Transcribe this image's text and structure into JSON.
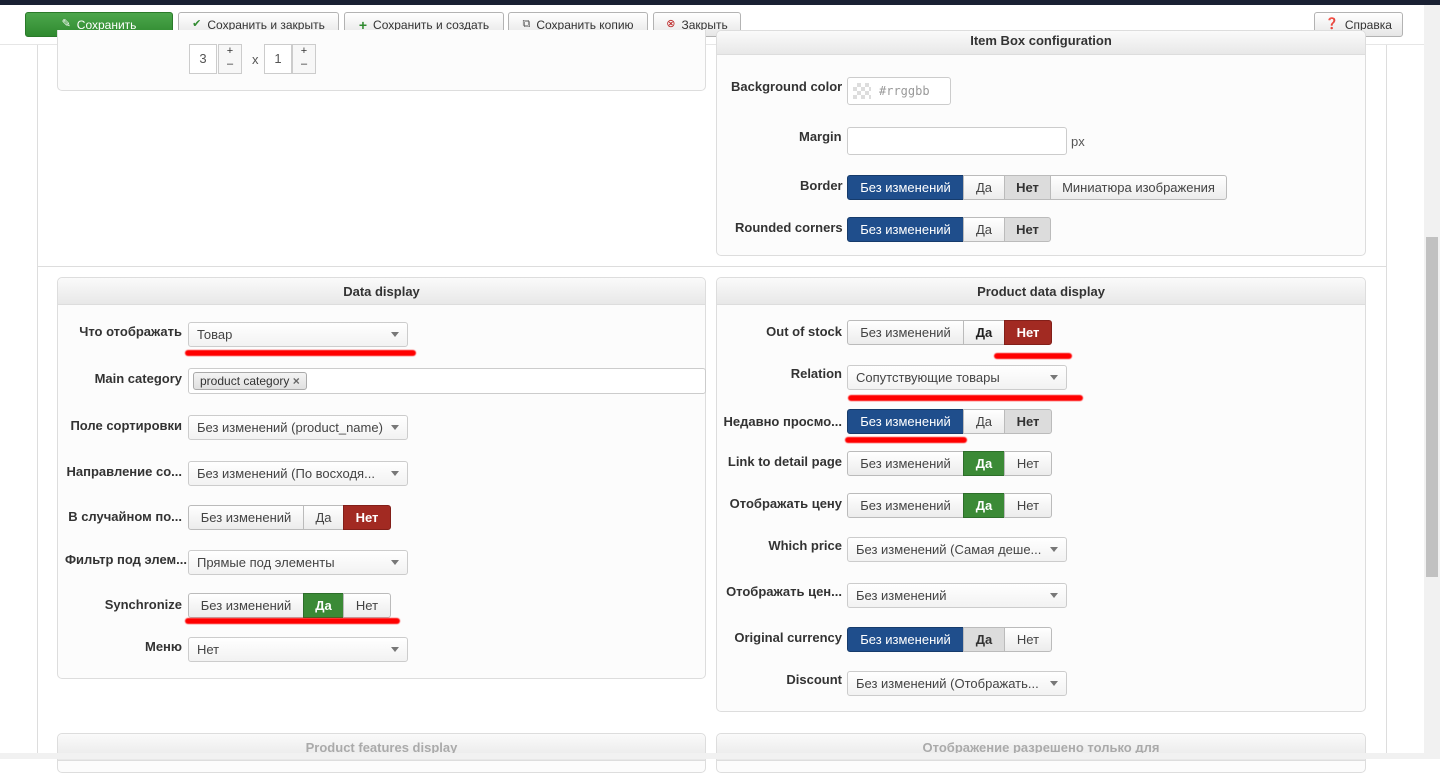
{
  "toolbar": {
    "save": "Сохранить",
    "save_close": "Сохранить и закрыть",
    "save_new": "Сохранить и создать",
    "save_copy": "Сохранить копию",
    "close": "Закрыть",
    "help": "Справка"
  },
  "grid": {
    "cols": "3",
    "x": "x",
    "rows": "1",
    "plus": "+",
    "minus": "–"
  },
  "item_box": {
    "title": "Item Box configuration",
    "bg_label": "Background color",
    "bg_placeholder": "#rrggbb",
    "margin_label": "Margin",
    "margin_unit": "px",
    "border_label": "Border",
    "border_options": [
      "Без изменений",
      "Да",
      "Нет",
      "Миниатюра изображения"
    ],
    "rounded_label": "Rounded corners",
    "rounded_options": [
      "Без изменений",
      "Да",
      "Нет"
    ]
  },
  "data_display": {
    "title": "Data display",
    "what_label": "Что отображать",
    "what_value": "Товар",
    "main_cat_label": "Main category",
    "main_cat_tag": "product category",
    "sort_label": "Поле сортировки",
    "sort_value": "Без изменений (product_name)",
    "direction_label": "Направление со...",
    "direction_value": "Без изменений (По восходя...",
    "random_label": "В случайном по...",
    "random_options": [
      "Без изменений",
      "Да",
      "Нет"
    ],
    "filter_label": "Фильтр под элем...",
    "filter_value": "Прямые под элементы",
    "sync_label": "Synchronize",
    "sync_options": [
      "Без изменений",
      "Да",
      "Нет"
    ],
    "menu_label": "Меню",
    "menu_value": "Нет"
  },
  "product_display": {
    "title": "Product data display",
    "oos_label": "Out of stock",
    "oos_options": [
      "Без изменений",
      "Да",
      "Нет"
    ],
    "relation_label": "Relation",
    "relation_value": "Сопутствующие товары",
    "recent_label": "Недавно просмо...",
    "recent_options": [
      "Без изменений",
      "Да",
      "Нет"
    ],
    "link_label": "Link to detail page",
    "link_options": [
      "Без изменений",
      "Да",
      "Нет"
    ],
    "price_label": "Отображать цену",
    "price_options": [
      "Без изменений",
      "Да",
      "Нет"
    ],
    "which_label": "Which price",
    "which_value": "Без изменений (Самая деше...",
    "price2_label": "Отображать цен...",
    "price2_value": "Без изменений",
    "orig_label": "Original currency",
    "orig_options": [
      "Без изменений",
      "Да",
      "Нет"
    ],
    "discount_label": "Discount",
    "discount_value": "Без изменений (Отображать..."
  },
  "bottom": {
    "features_title": "Product features display",
    "allowed_title": "Отображение разрешено только для"
  }
}
